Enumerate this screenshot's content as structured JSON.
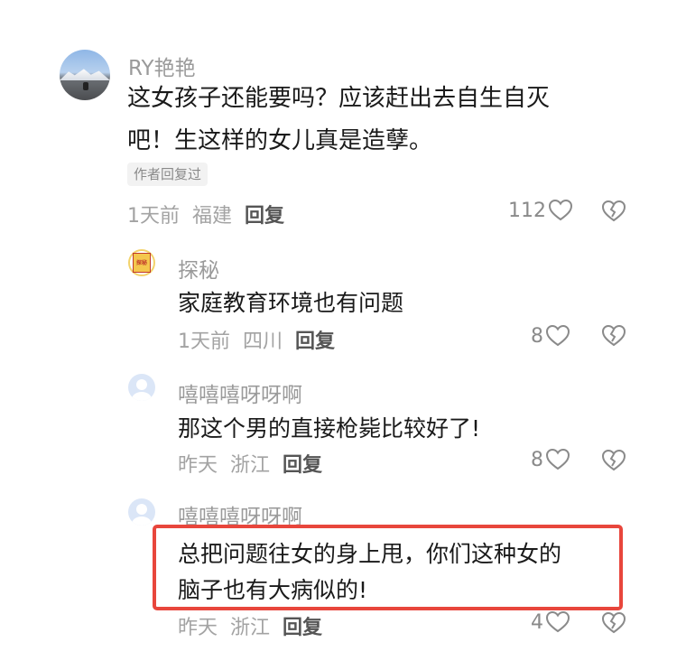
{
  "main_comment": {
    "username": "RY艳艳",
    "text_line1": "这女孩子还能要吗？应该赶出去自生自灭",
    "text_line2": "吧！生这样的女儿真是造孽。",
    "badge": "作者回复过",
    "time": "1天前",
    "region": "福建",
    "reply_label": "回复",
    "likes": "112"
  },
  "replies": [
    {
      "username": "探秘",
      "avatar_text": "探秘",
      "text": "家庭教育环境也有问题",
      "time": "1天前",
      "region": "四川",
      "reply_label": "回复",
      "likes": "8"
    },
    {
      "username": "嘻嘻嘻呀呀啊",
      "text": "那这个男的直接枪毙比较好了!",
      "time": "昨天",
      "region": "浙江",
      "reply_label": "回复",
      "likes": "8"
    },
    {
      "username": "嘻嘻嘻呀呀啊",
      "text_line1": "总把问题往女的身上甩，你们这种女的",
      "text_line2": "脑子也有大病似的!",
      "time": "昨天",
      "region": "浙江",
      "reply_label": "回复",
      "likes": "4"
    }
  ],
  "colors": {
    "highlight_border": "#e8463c",
    "meta_gray": "#a3a3a3",
    "username_gray": "#9a9a9a"
  },
  "icons": {
    "like": "heart-outline-icon",
    "dislike": "broken-heart-icon"
  }
}
